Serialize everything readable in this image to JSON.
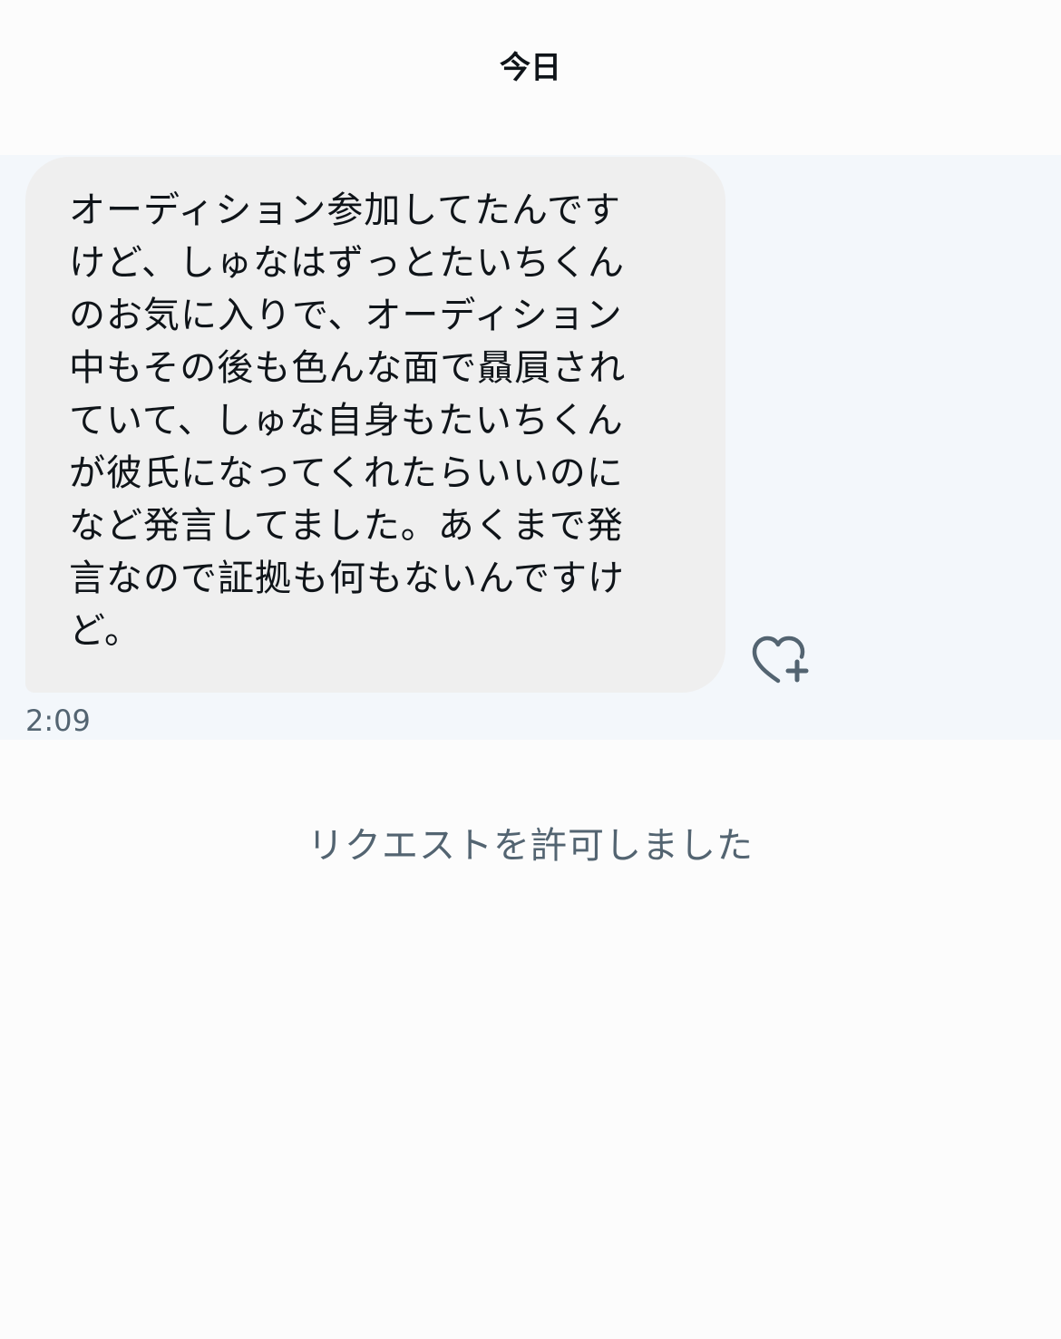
{
  "date_header": "今日",
  "message": {
    "text": "オーディション参加してたんです\nけど、しゅなはずっとたいちくん\nのお気に入りで、オーディション\n中もその後も色んな面で贔屓され\nていて、しゅな自身もたいちくん\nが彼氏になってくれたらいいのに\nなど発言してました。あくまで発\n言なので証拠も何もないんですけ\nど。",
    "timestamp": "2:09",
    "react_icon": "heart-plus-icon"
  },
  "system_message": "リクエストを許可しました",
  "colors": {
    "background": "#fcfcfc",
    "row_highlight": "#f3f7fb",
    "bubble": "#efefef",
    "text": "#0f1419",
    "secondary_text": "#536471"
  }
}
